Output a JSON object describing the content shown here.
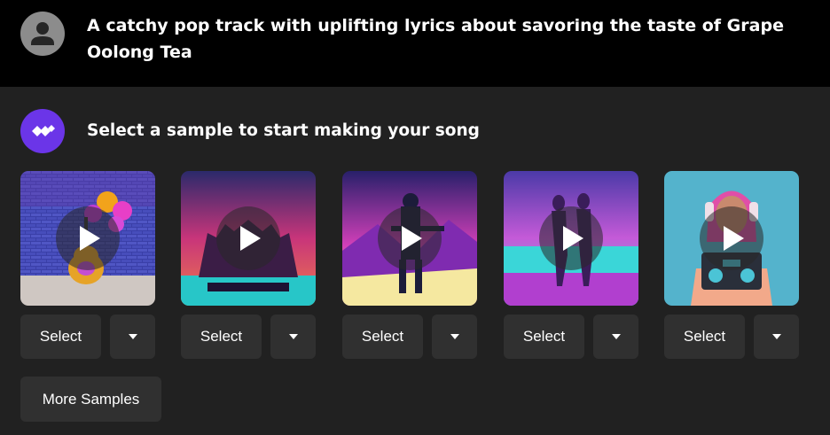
{
  "prompt": {
    "text": "A catchy pop track with uplifting lyrics about savoring the taste of Grape Oolong Tea"
  },
  "section": {
    "heading": "Select a sample to start making your song"
  },
  "samples": [
    {
      "image": "guitar-with-balloons-artwork",
      "select_label": "Select",
      "menu_icon": "caret-down-icon"
    },
    {
      "image": "synthwave-band-artwork",
      "select_label": "Select",
      "menu_icon": "caret-down-icon"
    },
    {
      "image": "retro-soldier-artwork",
      "select_label": "Select",
      "menu_icon": "caret-down-icon"
    },
    {
      "image": "women-on-beach-artwork",
      "select_label": "Select",
      "menu_icon": "caret-down-icon"
    },
    {
      "image": "woman-with-headphones-boombox-artwork",
      "select_label": "Select",
      "menu_icon": "caret-down-icon"
    }
  ],
  "more_samples_label": "More Samples",
  "colors": {
    "header_bg": "#000000",
    "page_bg": "#212121",
    "button_bg": "#303030",
    "brand": "#6b35e8",
    "text": "#ffffff"
  }
}
